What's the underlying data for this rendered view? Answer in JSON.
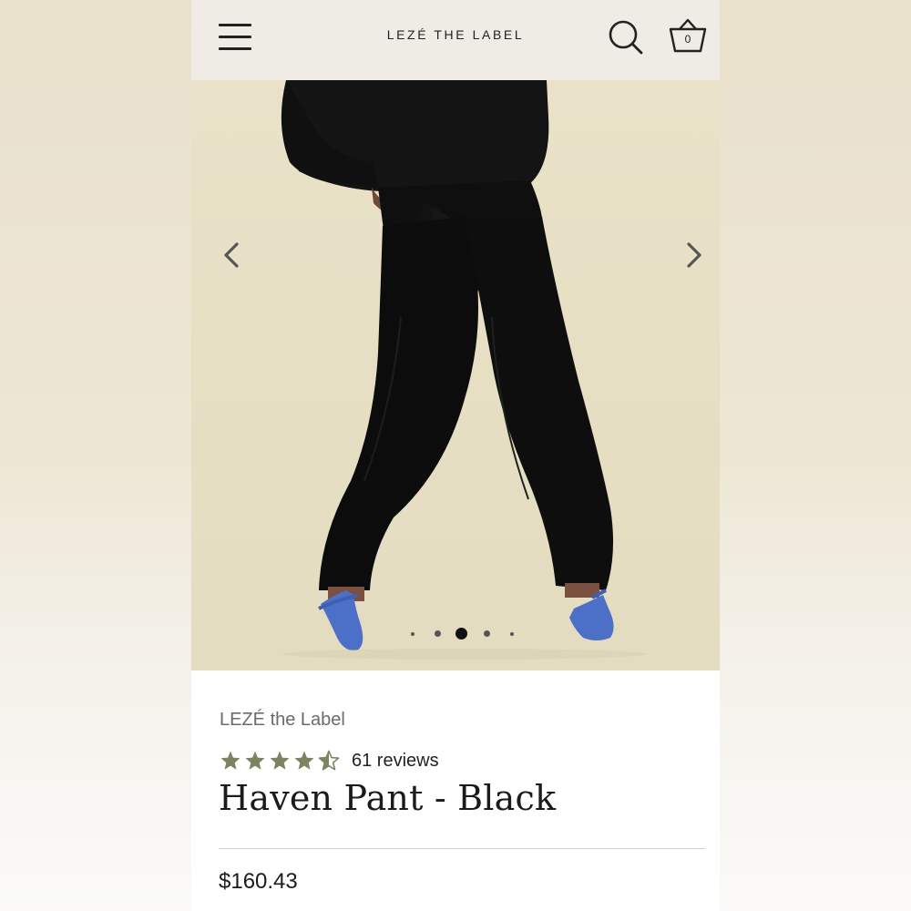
{
  "header": {
    "brand": "LEZÉ THE LABEL",
    "cart_count": "0",
    "menu_icon": "hamburger-menu-icon",
    "search_icon": "search-icon",
    "cart_icon": "basket-icon"
  },
  "gallery": {
    "prev_icon": "chevron-left-icon",
    "next_icon": "chevron-right-icon",
    "slide_count": 5,
    "active_slide": 3
  },
  "product": {
    "vendor": "LEZÉ the Label",
    "rating": 4.5,
    "reviews": "61 reviews",
    "title": "Haven Pant - Black",
    "price": "$160.43"
  },
  "colors": {
    "header_bg": "#efebe5",
    "star": "#7b8460",
    "text": "#1b1b1b"
  }
}
